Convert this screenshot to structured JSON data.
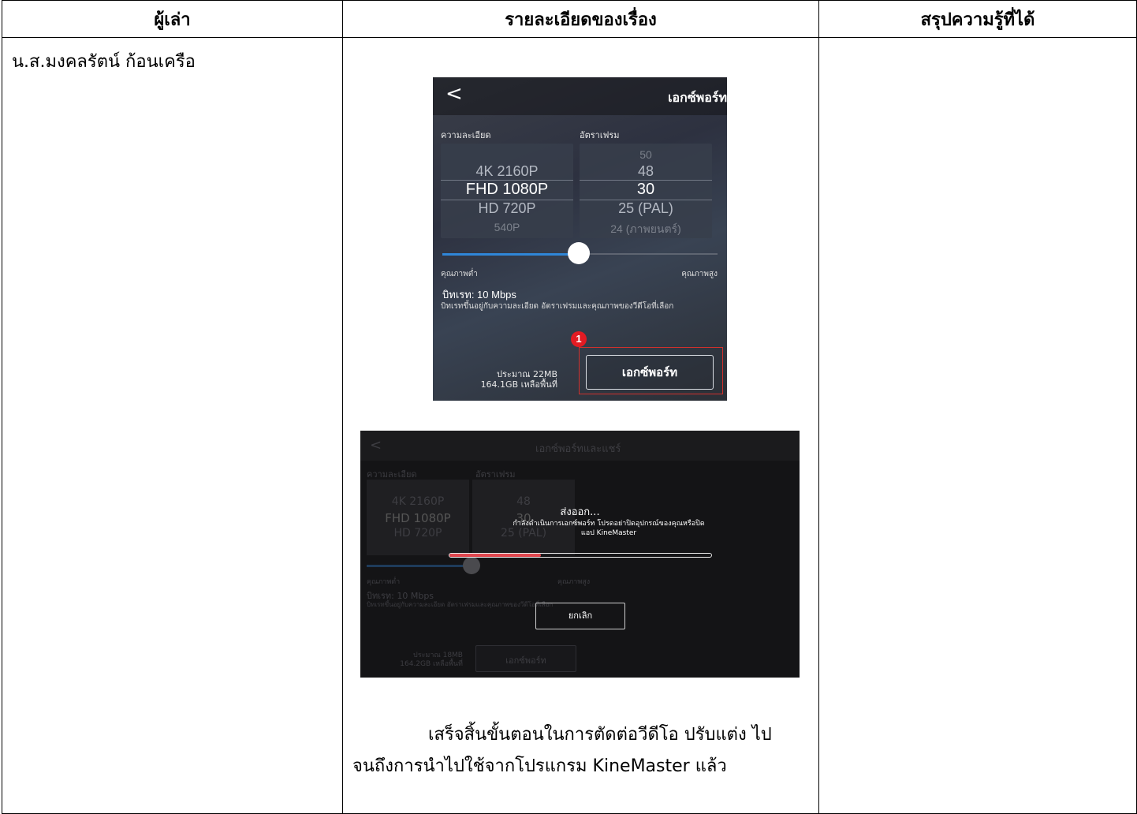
{
  "table": {
    "headers": [
      "ผู้เล่า",
      "รายละเอียดของเรื่อง",
      "สรุปความรู้ที่ได้"
    ],
    "narrator": "น.ส.มงคลรัตน์  ก้อนเครือ",
    "summary_line1": "เสร็จสิ้นขั้นตอนในการตัดต่อวีดีโอ ปรับแต่ง ไป",
    "summary_line2": "จนถึงการนำไปใช้จากโปรแกรม KineMaster แล้ว"
  },
  "screenshot1": {
    "back_glyph": "<",
    "title": "เอกซ์พอร์ท",
    "resolution_label": "ความละเอียด",
    "framerate_label": "อัตราเฟรม",
    "resolutions": [
      "",
      "4K 2160P",
      "FHD 1080P",
      "HD 720P",
      "540P"
    ],
    "framerates": [
      "50",
      "48",
      "30",
      "25 (PAL)",
      "24 (ภาพยนตร์)"
    ],
    "quality_low": "คุณภาพต่ำ",
    "quality_high": "คุณภาพสูง",
    "bitrate": "บิทเรท: 10 Mbps",
    "bitrate_note": "บิทเรทขึ้นอยู่กับความละเอียด อัตราเฟรมและคุณภาพของวีดีโอที่เลือก",
    "quality_slider_value": 0.5,
    "badge": "1",
    "size_estimate": "ประมาณ 22MB",
    "free_space": "164.1GB เหลือพื้นที่",
    "export_button": "เอกซ์พอร์ท",
    "highlight_color": "#d0312d",
    "slider_color": "#2f86d8"
  },
  "screenshot2": {
    "title": "เอกซ์พอร์ทและแชร์",
    "dialog_title": "ส่งออก...",
    "dialog_msg_line1": "กำลังดำเนินการเอกซ์พอร์ท โปรดอย่าปิดอุปกรณ์ของคุณหรือปิด",
    "dialog_msg_line2": "แอป KineMaster",
    "progress": 0.35,
    "progress_color": "#e0474f",
    "cancel": "ยกเลิก",
    "bg_resolution_label": "ความละเอียด",
    "bg_framerate_label": "อัตราเฟรม",
    "bg_resolutions": [
      "4K 2160P",
      "FHD 1080P",
      "HD 720P"
    ],
    "bg_framerates": [
      "48",
      "30",
      "25 (PAL)"
    ],
    "bg_quality_low": "คุณภาพต่ำ",
    "bg_quality_high": "คุณภาพสูง",
    "bg_bitrate": "บิทเรท: 10 Mbps",
    "bg_bitrate_note": "บิทเรทขึ้นอยู่กับความละเอียด อัตราเฟรมและคุณภาพของวีดีโอที่เลือก",
    "bg_size": "ประมาณ 18MB",
    "bg_free_space": "164.2GB เหลือพื้นที่",
    "bg_export": "เอกซ์พอร์ท"
  }
}
